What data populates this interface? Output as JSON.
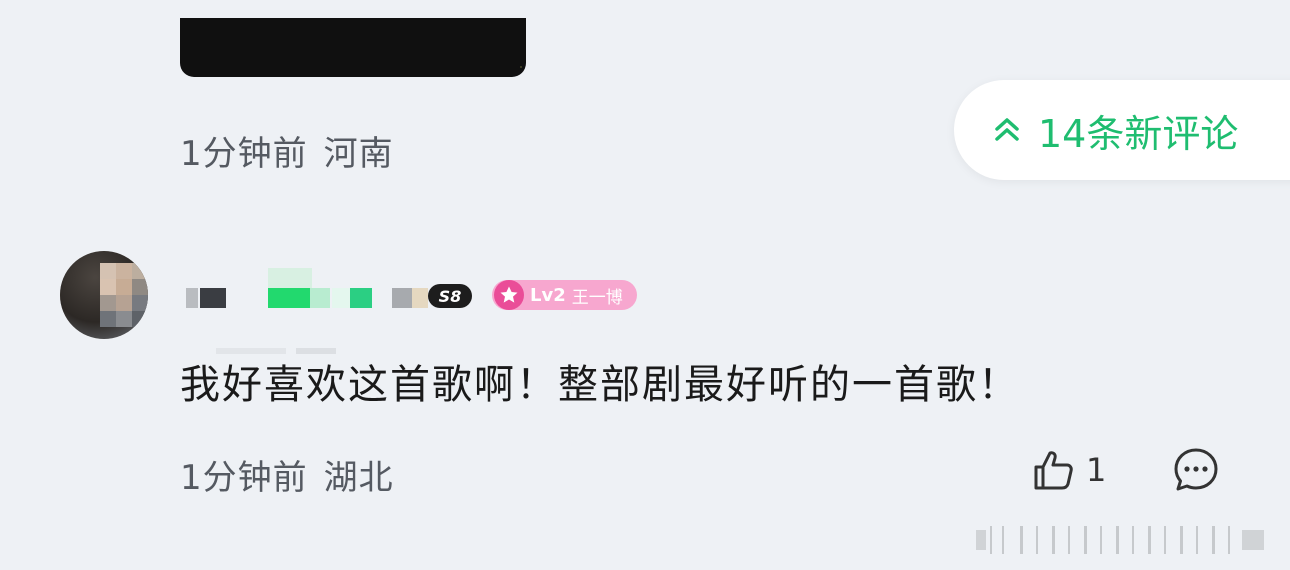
{
  "previous_comment": {
    "time": "1分钟前",
    "location": "河南"
  },
  "new_comments_pill": {
    "label": "14条新评论",
    "icon": "double-chevron-up-icon",
    "color": "#1fbd70"
  },
  "comment": {
    "level_badge": "S8",
    "fan_badge": {
      "level": "Lv2",
      "name": "王一博",
      "icon": "star-icon",
      "color": "#f7a7cf"
    },
    "text": "我好喜欢这首歌啊！整部剧最好听的一首歌！",
    "time": "1分钟前",
    "location": "湖北",
    "like_count": "1",
    "like_icon": "thumbs-up-icon",
    "reply_icon": "comment-bubble-icon"
  }
}
